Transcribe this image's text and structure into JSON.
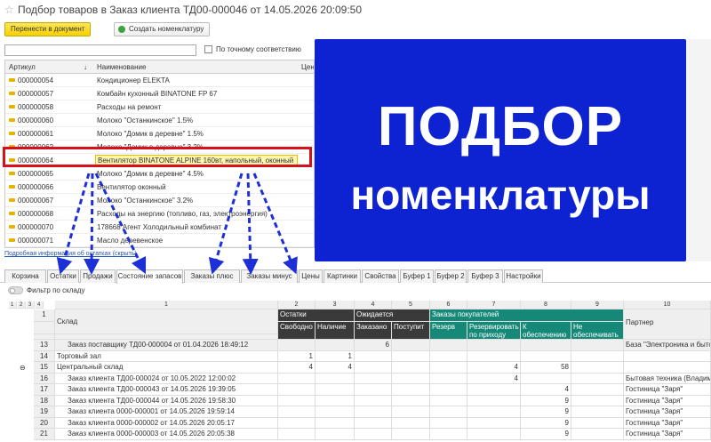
{
  "window": {
    "star": "☆",
    "title": "Подбор товаров в Заказ клиента ТД00-000046 от 14.05.2026 20:09:50"
  },
  "toolbar": {
    "transfer_label": "Перенести в документ",
    "create_label": "Создать номенклатуру"
  },
  "search": {
    "placeholder": "",
    "exact_label": "По точному соответствию"
  },
  "goods_table": {
    "col_article": "Артикул",
    "col_name": "Наименование",
    "col_price": "Цена",
    "rows": [
      {
        "article": "000000054",
        "name": "Кондиционер ELEKTA"
      },
      {
        "article": "000000057",
        "name": "Комбайн кухонный BINATONE FP 67"
      },
      {
        "article": "000000058",
        "name": "Расходы на ремонт"
      },
      {
        "article": "000000060",
        "name": "Молоко \"Останкинское\" 1.5%"
      },
      {
        "article": "000000061",
        "name": "Молоко \"Домик в деревне\" 1.5%"
      },
      {
        "article": "000000062",
        "name": "Молоко \"Домик в деревне\" 3.2%"
      },
      {
        "article": "000000064",
        "name": "Вентилятор BINATONE ALPINE 160вт, напольный, оконный"
      },
      {
        "article": "000000065",
        "name": "Молоко \"Домик в деревне\" 4.5%"
      },
      {
        "article": "000000066",
        "name": "Вентилятор оконный"
      },
      {
        "article": "000000067",
        "name": "Молоко \"Останкинское\" 3.2%"
      },
      {
        "article": "000000068",
        "name": "Расходы на энергию (топливо, газ, электроэнергия)"
      },
      {
        "article": "000000070",
        "name": "178668 Агент Холодильный комбинат"
      },
      {
        "article": "000000071",
        "name": "Масло деревенское"
      }
    ]
  },
  "banner": {
    "line1": "ПОДБОР",
    "line2": "номенклатуры"
  },
  "detail_link": "Подробная информация об остатках (скрыть)",
  "tabs": [
    "Корзина",
    "Остатки",
    "Продажи",
    "Состояние запасов",
    "Заказы плюс",
    "Заказы минус",
    "Цены",
    "Картинки",
    "Свойства",
    "Буфер 1",
    "Буфер 2",
    "Буфер 3",
    "Настройки"
  ],
  "filter": {
    "label": "Фильтр по складу"
  },
  "stock_table": {
    "level_buttons": [
      "1",
      "2",
      "3",
      "4"
    ],
    "col_numbers": [
      "1",
      "2",
      "3",
      "4",
      "5",
      "6",
      "7",
      "8",
      "9",
      "10"
    ],
    "row1_num": "1",
    "warehouse": "Склад",
    "group_ostatki": "Остатки",
    "group_ozhidaetsya": "Ожидается",
    "group_zakazy": "Заказы покупателей",
    "h_svobodno": "Свободно",
    "h_nalichie": "Наличие",
    "h_zakazano": "Заказано",
    "h_postupit": "Поступит",
    "h_rezerv": "Резерв",
    "h_rezerv_prihod": "Резервировать по приходу",
    "h_k_obesp": "К обеспечению",
    "h_ne_obesp": "Не обеспечивать",
    "h_partner": "Партнер",
    "rows": [
      {
        "n": "13",
        "name": "Заказ поставщику ТД00-000004 от 01.04.2026 18:49:12",
        "svob": "",
        "nal": "",
        "zak": "6",
        "post": "",
        "rez": "",
        "rp": "",
        "ko": "",
        "no": "",
        "partner": "База \"Электроника и быто"
      },
      {
        "n": "14",
        "name": "Торговый зал",
        "svob": "1",
        "nal": "1",
        "zak": "",
        "post": "",
        "rez": "",
        "rp": "",
        "ko": "",
        "no": "",
        "partner": ""
      },
      {
        "n": "15",
        "name": "Центральный склад",
        "svob": "4",
        "nal": "4",
        "zak": "",
        "post": "",
        "rez": "",
        "rp": "4",
        "ko": "58",
        "no": "",
        "partner": ""
      },
      {
        "n": "16",
        "name": "Заказ клиента ТД00-000024 от 10.05.2022 12:00:02",
        "svob": "",
        "nal": "",
        "zak": "",
        "post": "",
        "rez": "",
        "rp": "4",
        "ko": "",
        "no": "",
        "partner": "Бытовая техника (Владими"
      },
      {
        "n": "17",
        "name": "Заказ клиента ТД00-000043 от 14.05.2026 19:39:05",
        "svob": "",
        "nal": "",
        "zak": "",
        "post": "",
        "rez": "",
        "rp": "",
        "ko": "4",
        "no": "",
        "partner": "Гостиница \"Заря\""
      },
      {
        "n": "18",
        "name": "Заказ клиента ТД00-000044 от 14.05.2026 19:58:30",
        "svob": "",
        "nal": "",
        "zak": "",
        "post": "",
        "rez": "",
        "rp": "",
        "ko": "9",
        "no": "",
        "partner": "Гостиница \"Заря\""
      },
      {
        "n": "19",
        "name": "Заказ клиента 0000-000001 от 14.05.2026 19:59:14",
        "svob": "",
        "nal": "",
        "zak": "",
        "post": "",
        "rez": "",
        "rp": "",
        "ko": "9",
        "no": "",
        "partner": "Гостиница \"Заря\""
      },
      {
        "n": "20",
        "name": "Заказ клиента 0000-000002 от 14.05.2026 20:05:17",
        "svob": "",
        "nal": "",
        "zak": "",
        "post": "",
        "rez": "",
        "rp": "",
        "ko": "9",
        "no": "",
        "partner": "Гостиница \"Заря\""
      },
      {
        "n": "21",
        "name": "Заказ клиента 0000-000003 от 14.05.2026 20:05:38",
        "svob": "",
        "nal": "",
        "zak": "",
        "post": "",
        "rez": "",
        "rp": "",
        "ko": "9",
        "no": "",
        "partner": "Гостиница \"Заря\""
      }
    ]
  },
  "colors": {
    "banner": "#0d22d0",
    "highlight": "#d6111b",
    "arrows": "#1d2fd6",
    "teal": "#158878",
    "dark": "#3a3a3a"
  }
}
